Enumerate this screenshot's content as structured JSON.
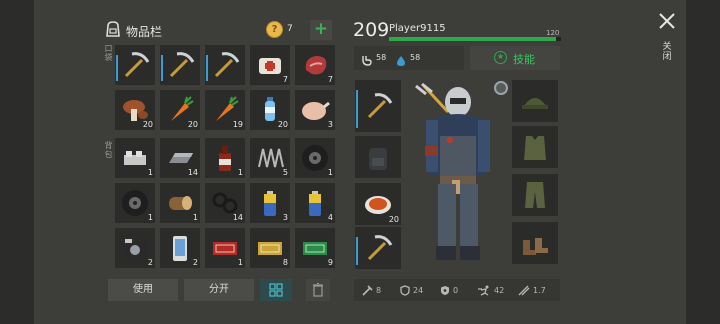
{
  "inventory": {
    "title": "物品栏",
    "coins": "7",
    "add_label": "+",
    "pocket_label": "口袋",
    "backpack_label": "背包",
    "pocket_slots": [
      {
        "icon": "pickaxe-icon",
        "count": ""
      },
      {
        "icon": "pickaxe-icon",
        "count": ""
      },
      {
        "icon": "pickaxe-icon",
        "count": ""
      },
      {
        "icon": "bandage-icon",
        "count": "7"
      },
      {
        "icon": "raw-meat-icon",
        "count": "7"
      },
      {
        "icon": "mushroom-icon",
        "count": "20"
      },
      {
        "icon": "carrot-icon",
        "count": "20"
      },
      {
        "icon": "carrot-icon",
        "count": "19"
      },
      {
        "icon": "water-bottle-icon",
        "count": "20"
      },
      {
        "icon": "chicken-icon",
        "count": "3"
      }
    ],
    "backpack_slots": [
      {
        "icon": "metal-parts-icon",
        "count": "1"
      },
      {
        "icon": "iron-bar-icon",
        "count": "14"
      },
      {
        "icon": "bottle-icon",
        "count": "1"
      },
      {
        "icon": "spring-icon",
        "count": "5"
      },
      {
        "icon": "tire-icon",
        "count": "1"
      },
      {
        "icon": "tire-icon",
        "count": "1"
      },
      {
        "icon": "log-icon",
        "count": "1"
      },
      {
        "icon": "rubber-rings-icon",
        "count": "14"
      },
      {
        "icon": "battery-icon",
        "count": "3"
      },
      {
        "icon": "battery-icon",
        "count": "4"
      },
      {
        "icon": "camera-icon",
        "count": "2"
      },
      {
        "icon": "phone-icon",
        "count": "2"
      },
      {
        "icon": "red-ticket-icon",
        "count": "1"
      },
      {
        "icon": "yellow-ticket-icon",
        "count": "8"
      },
      {
        "icon": "green-ticket-icon",
        "count": "9"
      }
    ],
    "use_label": "使用",
    "split_label": "分开"
  },
  "player": {
    "level": "209",
    "name": "Player9115",
    "xp_max": "120",
    "xp_progress": 0.97,
    "food": "58",
    "water": "58",
    "skills_label": "技能",
    "quick_slots": [
      {
        "icon": "pickaxe-icon",
        "count": ""
      },
      {
        "icon": "backpack-icon",
        "count": ""
      },
      {
        "icon": "food-plate-icon",
        "count": "20"
      },
      {
        "icon": "pickaxe-icon",
        "count": ""
      }
    ],
    "armor_slots": [
      {
        "icon": "hat-icon"
      },
      {
        "icon": "vest-icon"
      },
      {
        "icon": "pants-icon"
      },
      {
        "icon": "boots-icon"
      }
    ],
    "stats": {
      "attack": "8",
      "defense": "24",
      "radiation": "0",
      "speed": "42",
      "damage_mult": "1.7"
    }
  },
  "close_label": "关闭",
  "colors": {
    "accent": "#2ea84a",
    "durability": "#3b9bd6",
    "coin": "#e8b84a"
  }
}
